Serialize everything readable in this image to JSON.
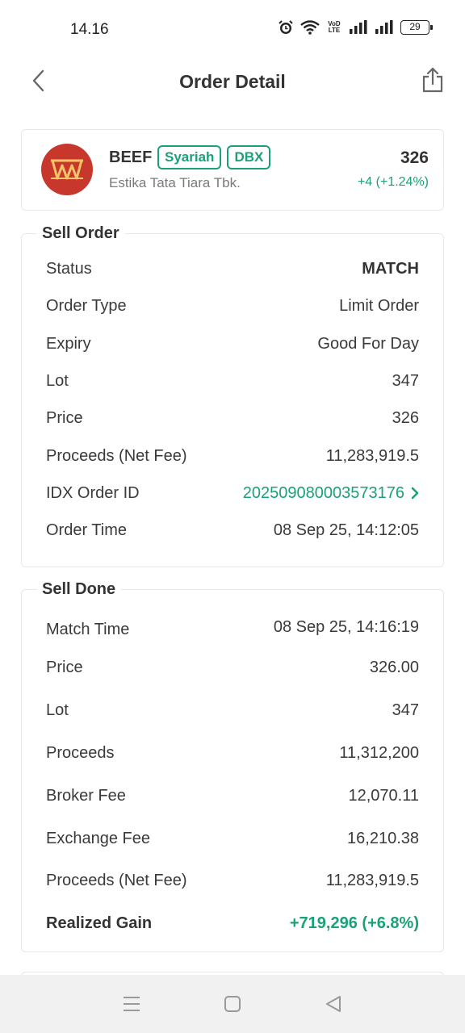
{
  "status_bar": {
    "time": "14.16",
    "network_label": "VoD LTE",
    "battery": "29"
  },
  "header": {
    "title": "Order Detail"
  },
  "stock": {
    "code": "BEEF",
    "tags": [
      "Syariah",
      "DBX"
    ],
    "name": "Estika Tata Tiara Tbk.",
    "price": "326",
    "change": "+4 (+1.24%)"
  },
  "sell_order": {
    "title": "Sell Order",
    "rows": [
      {
        "label": "Status",
        "value": "MATCH"
      },
      {
        "label": "Order Type",
        "value": "Limit Order"
      },
      {
        "label": "Expiry",
        "value": "Good For Day"
      },
      {
        "label": "Lot",
        "value": "347"
      },
      {
        "label": "Price",
        "value": "326"
      },
      {
        "label": "Proceeds (Net Fee)",
        "value": "11,283,919.5"
      },
      {
        "label": "IDX Order ID",
        "value": "202509080003573176"
      },
      {
        "label": "Order Time",
        "value": "08 Sep 25, 14:12:05"
      }
    ]
  },
  "sell_done": {
    "title": "Sell Done",
    "rows": [
      {
        "label": "Match Time",
        "value": "08 Sep 25, 14:16:19"
      },
      {
        "label": "Price",
        "value": "326.00"
      },
      {
        "label": "Lot",
        "value": "347"
      },
      {
        "label": "Proceeds",
        "value": "11,312,200"
      },
      {
        "label": "Broker Fee",
        "value": "12,070.11"
      },
      {
        "label": "Exchange Fee",
        "value": "16,210.38"
      },
      {
        "label": "Proceeds (Net Fee)",
        "value": "11,283,919.5"
      },
      {
        "label": "Realized Gain",
        "value": "+719,296 (+6.8%)"
      }
    ]
  },
  "colors": {
    "accent": "#1aa17a",
    "logo_bg": "#c8372c",
    "logo_mark": "#f2c46a"
  },
  "icons": {
    "back": "chevron-left-icon",
    "share": "share-icon",
    "idx_link": "chevron-right-icon",
    "nav_menu": "menu-icon",
    "nav_home": "square-icon",
    "nav_back": "triangle-back-icon"
  }
}
